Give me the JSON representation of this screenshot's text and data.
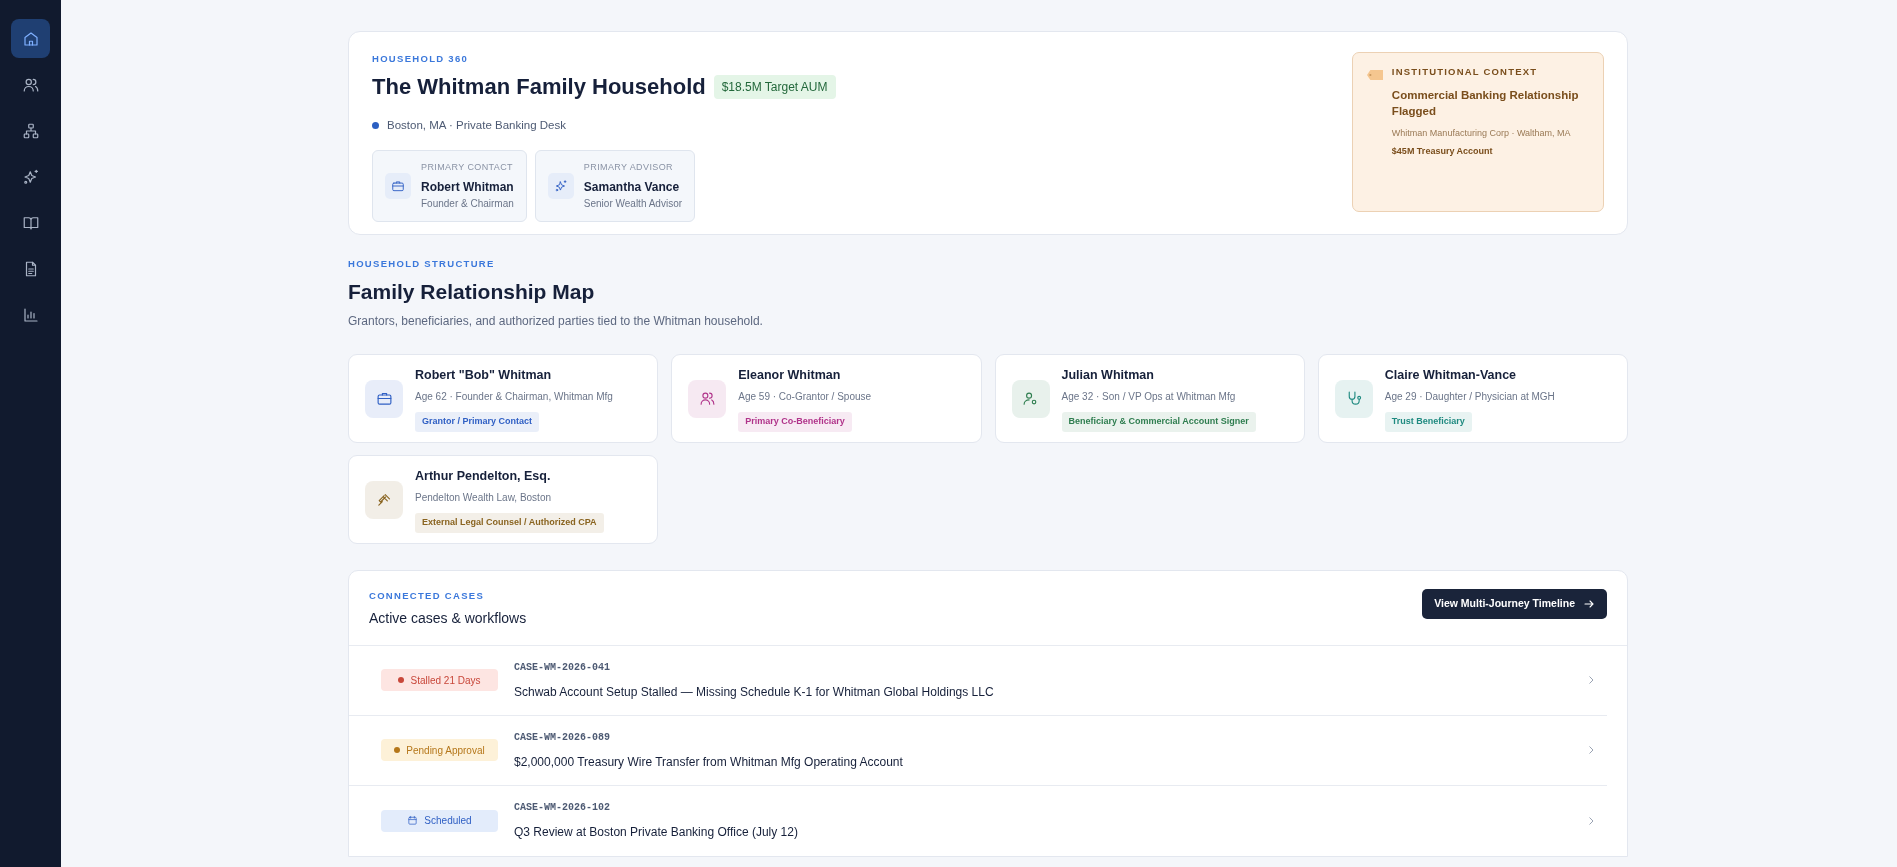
{
  "sidebar": {
    "items": [
      {
        "selected": true
      },
      {
        "selected": false
      },
      {
        "selected": false
      },
      {
        "selected": false
      },
      {
        "selected": false
      },
      {
        "selected": false
      },
      {
        "selected": false
      }
    ]
  },
  "header": {
    "eyebrow": "HOUSEHOLD 360",
    "title": "The Whitman Family Household",
    "aum_badge": "$18.5M Target AUM",
    "location": "Boston, MA · Private Banking Desk",
    "contacts": [
      {
        "label": "PRIMARY CONTACT",
        "name": "Robert Whitman",
        "role": "Founder & Chairman"
      },
      {
        "label": "PRIMARY ADVISOR",
        "name": "Samantha Vance",
        "role": "Senior Wealth Advisor"
      }
    ],
    "context": {
      "eyebrow": "INSTITUTIONAL CONTEXT",
      "title": "Commercial Banking Relationship Flagged",
      "company": "Whitman Manufacturing Corp · Waltham, MA",
      "account": "$45M Treasury Account"
    }
  },
  "structure": {
    "eyebrow": "HOUSEHOLD STRUCTURE",
    "title": "Family Relationship Map",
    "subtitle": "Grantors, beneficiaries, and authorized parties tied to the Whitman household.",
    "members": [
      {
        "name": "Robert \"Bob\" Whitman",
        "detail": "Age 62 · Founder & Chairman, Whitman Mfg",
        "tag": "Grantor / Primary Contact",
        "color": "#2f5fc4"
      },
      {
        "name": "Eleanor Whitman",
        "detail": "Age 59 · Co-Grantor / Spouse",
        "tag": "Primary Co-Beneficiary",
        "color": "#b0338a"
      },
      {
        "name": "Julian Whitman",
        "detail": "Age 32 · Son / VP Ops at Whitman Mfg",
        "tag": "Beneficiary & Commercial Account Signer",
        "color": "#2e7d4f"
      },
      {
        "name": "Claire Whitman-Vance",
        "detail": "Age 29 · Daughter / Physician at MGH",
        "tag": "Trust Beneficiary",
        "color": "#1f8a80"
      },
      {
        "name": "Arthur Pendelton, Esq.",
        "detail": "Pendelton Wealth Law, Boston",
        "tag": "External Legal Counsel / Authorized CPA",
        "color": "#8a6420"
      }
    ]
  },
  "cases": {
    "eyebrow": "CONNECTED CASES",
    "title": "Active cases & workflows",
    "button": "View Multi-Journey Timeline",
    "rows": [
      {
        "status": "Stalled 21 Days",
        "kind": "stalled",
        "id": "CASE-WM-2026-041",
        "title": "Schwab Account Setup Stalled — Missing Schedule K-1 for Whitman Global Holdings LLC"
      },
      {
        "status": "Pending Approval",
        "kind": "pending",
        "id": "CASE-WM-2026-089",
        "title": "$2,000,000 Treasury Wire Transfer from Whitman Mfg Operating Account"
      },
      {
        "status": "Scheduled",
        "kind": "scheduled",
        "id": "CASE-WM-2026-102",
        "title": "Q3 Review at Boston Private Banking Office (July 12)"
      }
    ]
  }
}
